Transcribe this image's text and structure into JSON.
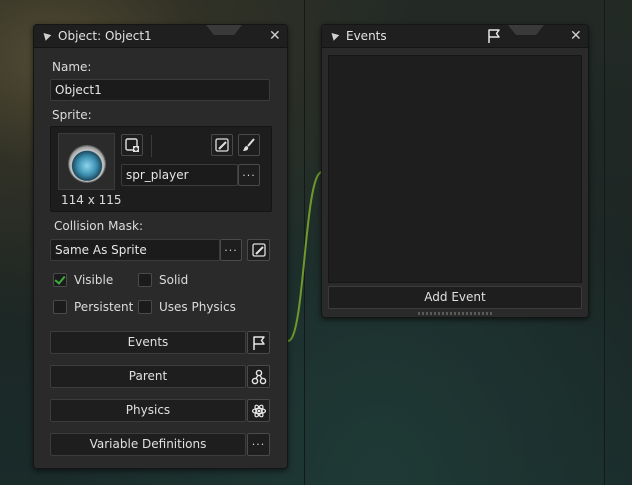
{
  "object_panel": {
    "title": "Object: Object1",
    "name_label": "Name:",
    "name_value": "Object1",
    "sprite_label": "Sprite:",
    "sprite_name": "spr_player",
    "sprite_size": "114 x 115",
    "collision_mask_label": "Collision Mask:",
    "collision_mask_value": "Same As Sprite",
    "ellipsis": "···",
    "checkboxes": [
      {
        "label": "Visible",
        "checked": true
      },
      {
        "label": "Solid",
        "checked": false
      },
      {
        "label": "Persistent",
        "checked": false
      },
      {
        "label": "Uses Physics",
        "checked": false
      }
    ],
    "buttons": {
      "events": "Events",
      "parent": "Parent",
      "physics": "Physics",
      "variable_definitions": "Variable Definitions"
    }
  },
  "events_panel": {
    "title": "Events",
    "add_event_label": "Add Event"
  },
  "colors": {
    "connector": "#6f9a2a",
    "check": "#3fae3f"
  }
}
